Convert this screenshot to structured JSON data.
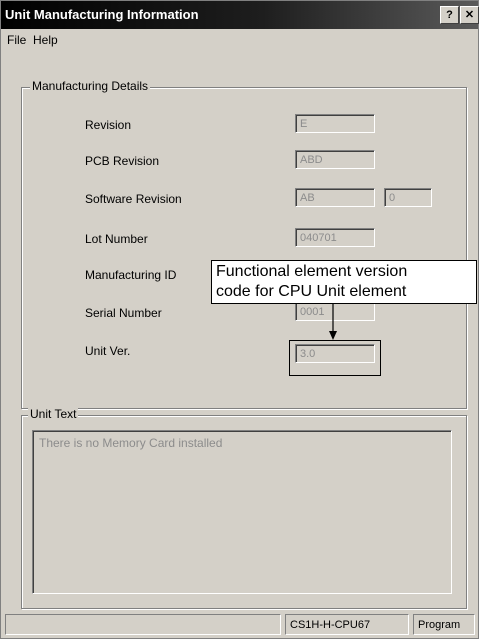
{
  "window": {
    "title": "Unit Manufacturing Information",
    "help_glyph": "?",
    "close_glyph": "✕"
  },
  "menu": {
    "file": "File",
    "help": "Help"
  },
  "manufacturing": {
    "group_title": "Manufacturing Details",
    "revision_label": "Revision",
    "revision_value": "E",
    "pcb_revision_label": "PCB Revision",
    "pcb_revision_value": "ABD",
    "software_revision_label": "Software Revision",
    "software_revision_value": "AB",
    "software_revision_value2": "0",
    "lot_number_label": "Lot Number",
    "lot_number_value": "040701",
    "manufacturing_id_label": "Manufacturing ID",
    "serial_number_label": "Serial Number",
    "serial_number_value": "0001",
    "unit_ver_label": "Unit Ver.",
    "unit_ver_value": "3.0"
  },
  "unit_text": {
    "group_title": "Unit Text",
    "content": "There is no Memory Card installed"
  },
  "status": {
    "model": "CS1H-H-CPU67",
    "mode": "Program"
  },
  "callout": {
    "line1": "Functional element version",
    "line2": "code for CPU Unit element"
  }
}
